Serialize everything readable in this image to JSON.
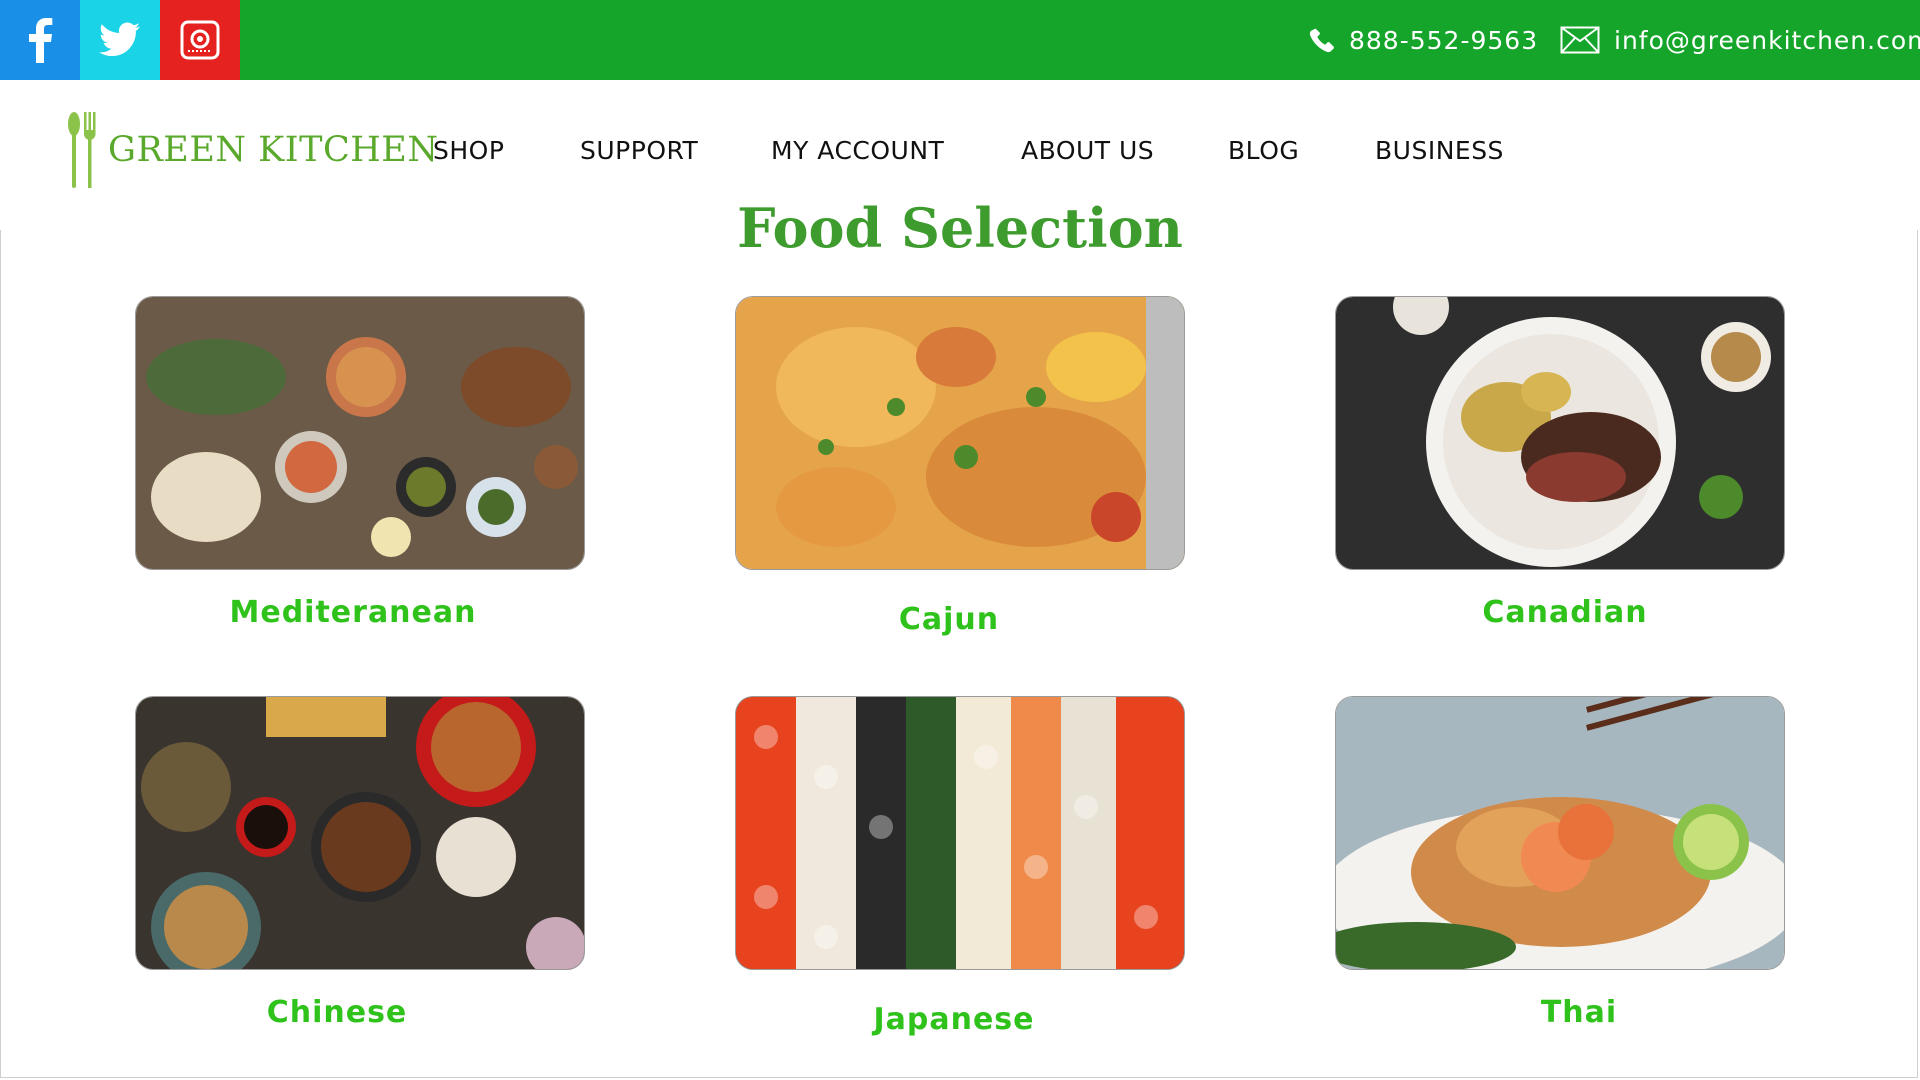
{
  "contact": {
    "phone": "888-552-9563",
    "email": "info@greenkitchen.com"
  },
  "social": {
    "icons": [
      "facebook-icon",
      "twitter-icon",
      "instagram-icon"
    ],
    "colors": {
      "facebook": "#1a8fe8",
      "twitter": "#1ad3e6",
      "instagram": "#e5221f"
    }
  },
  "brand": {
    "name": "GREEN KITCHEN",
    "logo_icon": "fork-spoon-icon",
    "color": "#5aa92c"
  },
  "nav": {
    "items": [
      "SHOP",
      "SUPPORT",
      "MY ACCOUNT",
      "ABOUT US",
      "BLOG",
      "BUSINESS"
    ]
  },
  "main": {
    "title": "Food Selection",
    "cuisines": [
      {
        "label": "Mediteranean"
      },
      {
        "label": "Cajun"
      },
      {
        "label": "Canadian"
      },
      {
        "label": "Chinese"
      },
      {
        "label": "Japanese"
      },
      {
        "label": "Thai"
      }
    ]
  },
  "colors": {
    "topbar": "#14a52a",
    "title": "#3e9b2d",
    "label": "#2ec21b"
  }
}
